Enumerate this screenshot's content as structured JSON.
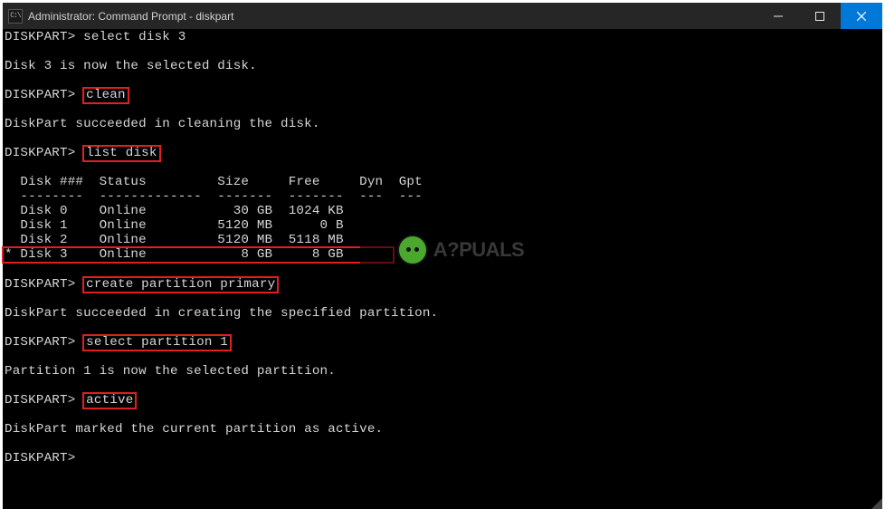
{
  "titlebar": {
    "icon_label": "CMD",
    "title": "Administrator: Command Prompt - diskpart"
  },
  "prompt": "DISKPART>",
  "lines": {
    "l1_cmd": "select disk 3",
    "l2_msg": "Disk 3 is now the selected disk.",
    "l3_cmd": "clean",
    "l4_msg": "DiskPart succeeded in cleaning the disk.",
    "l5_cmd": "list disk",
    "table_header": "  Disk ###  Status         Size     Free     Dyn  Gpt",
    "table_divider": "  --------  -------------  -------  -------  ---  ---",
    "row0": "  Disk 0    Online           30 GB  1024 KB",
    "row1": "  Disk 1    Online         5120 MB      0 B",
    "row2": "  Disk 2    Online         5120 MB  5118 MB",
    "row3": "* Disk 3    Online            8 GB     8 GB",
    "l6_cmd": "create partition primary",
    "l7_msg": "DiskPart succeeded in creating the specified partition.",
    "l8_cmd": "select partition 1",
    "l9_msg": "Partition 1 is now the selected partition.",
    "l10_cmd": "active",
    "l11_msg": "DiskPart marked the current partition as active."
  },
  "chart_data": {
    "type": "table",
    "columns": [
      "Disk ###",
      "Status",
      "Size",
      "Free",
      "Dyn",
      "Gpt"
    ],
    "rows": [
      {
        "selected": false,
        "disk": "Disk 0",
        "status": "Online",
        "size": "30 GB",
        "free": "1024 KB",
        "dyn": "",
        "gpt": ""
      },
      {
        "selected": false,
        "disk": "Disk 1",
        "status": "Online",
        "size": "5120 MB",
        "free": "0 B",
        "dyn": "",
        "gpt": ""
      },
      {
        "selected": false,
        "disk": "Disk 2",
        "status": "Online",
        "size": "5120 MB",
        "free": "5118 MB",
        "dyn": "",
        "gpt": ""
      },
      {
        "selected": true,
        "disk": "Disk 3",
        "status": "Online",
        "size": "8 GB",
        "free": "8 GB",
        "dyn": "",
        "gpt": ""
      }
    ]
  },
  "watermark": {
    "text": "A?PUALS"
  },
  "highlight_color": "#e02020"
}
